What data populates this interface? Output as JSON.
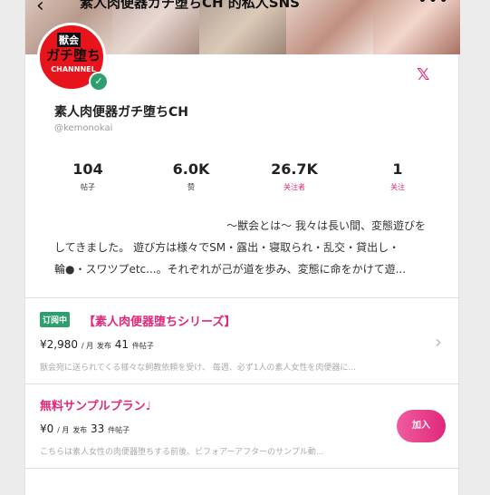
{
  "header": {
    "title": "素人肉便器ガチ堕ちCH 的私人SNS",
    "back_icon": "chevron-left-icon",
    "more_icon": "more-icon"
  },
  "profile": {
    "avatar_text_1": "獣会",
    "avatar_text_2": "ガチ堕ち",
    "avatar_text_3": "CHANNNEL",
    "name": "素人肉便器ガチ堕ちCH",
    "handle": "@kemonokai",
    "social_icon": "x-icon",
    "verified_icon": "verified-check-icon"
  },
  "stats": [
    {
      "value": "104",
      "label": "帖子"
    },
    {
      "value": "6.0K",
      "label": "赞"
    },
    {
      "value": "26.7K",
      "label": "关注者"
    },
    {
      "value": "1",
      "label": "关注"
    }
  ],
  "bio": {
    "line1": "〜獣会とは〜 我々は長い間、変態遊びを",
    "line2": "してきました。 遊び方は様々でSM・露出・寝取られ・乱交・貸出し・",
    "line3": "輪●・スワツプetc...。それぞれが己が道を歩み、変態に命をかけて遊..."
  },
  "plans": [
    {
      "badge": "订阅中",
      "title": "【素人肉便器堕ちシリーズ】",
      "price": "¥2,980",
      "unit": "/ 月",
      "posts_label": "发布",
      "posts_count": "41",
      "posts_suffix": "件帖子",
      "description": "獣会宛に送られてくる様々な飼教依頼を受け、 毎週、必ず1人の素人女性を肉便器に..."
    },
    {
      "title": "無料サンプルプラン♩",
      "price": "¥0",
      "unit": "/ 月",
      "posts_label": "发布",
      "posts_count": "33",
      "posts_suffix": "件帖子",
      "description": "こちらは素人女性の肉便器堕ちする前後、ビフォアーアフターのサンプル動...",
      "join_label": "加入"
    }
  ],
  "colors": {
    "accent": "#e0287a",
    "badge": "#2e9e6e",
    "avatar_red": "#e8141b"
  }
}
